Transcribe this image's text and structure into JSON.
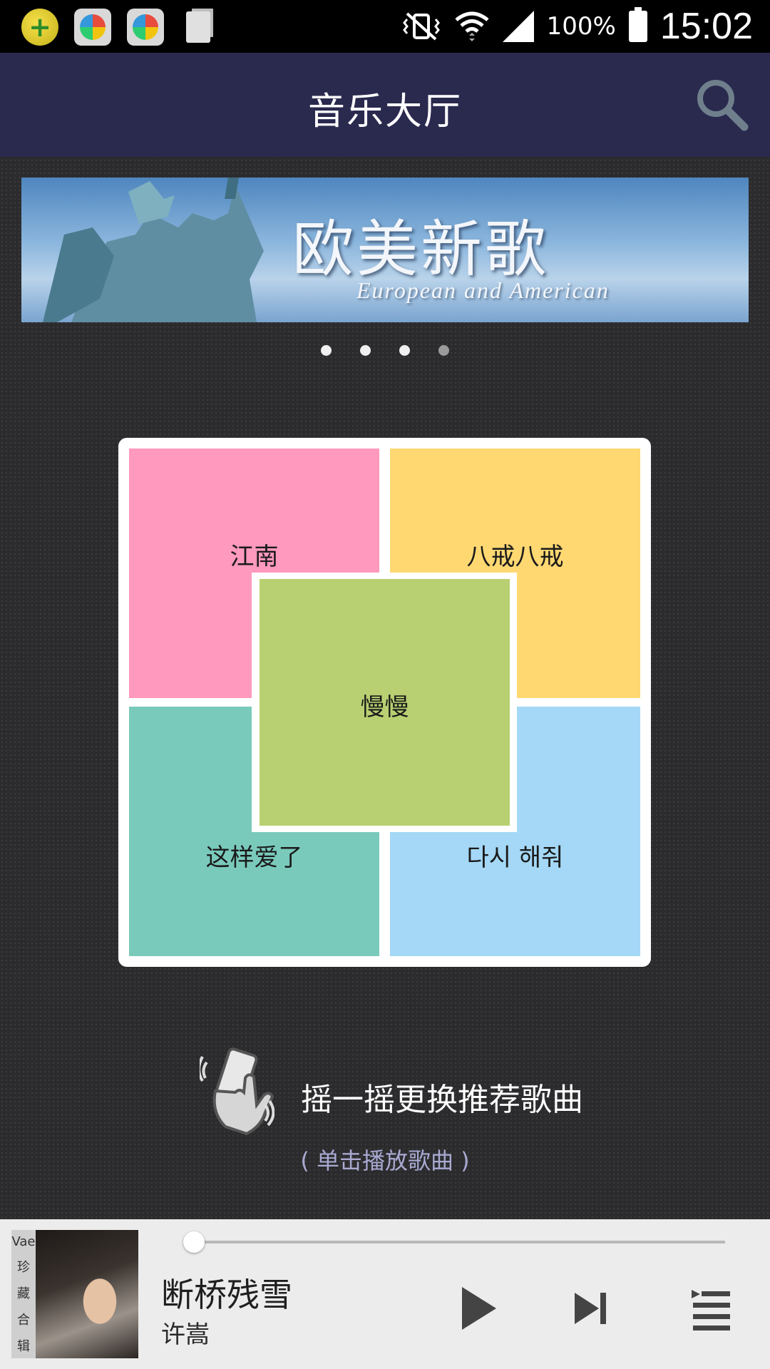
{
  "status_bar": {
    "battery_percent": "100%",
    "time": "15:02",
    "icons": [
      "360-plus-icon",
      "app-ball-icon",
      "app-ball-icon",
      "document-icon",
      "vibrate-mute-icon",
      "wifi-icon",
      "signal-icon",
      "battery-icon"
    ]
  },
  "header": {
    "title": "音乐大厅",
    "search_icon": "search-icon"
  },
  "banner": {
    "title": "欧美新歌",
    "subtitle": "European and American",
    "page_count": 4,
    "active_page": 4
  },
  "recommend": {
    "tiles": [
      {
        "label": "江南",
        "color": "#ff99be"
      },
      {
        "label": "八戒八戒",
        "color": "#ffd872"
      },
      {
        "label": "这样爱了",
        "color": "#7acabc"
      },
      {
        "label": "다시 해줘",
        "color": "#a4d8f6"
      }
    ],
    "center": {
      "label": "慢慢",
      "color": "#b8d072"
    }
  },
  "shake": {
    "label": "摇一摇更换推荐歌曲",
    "hint": "( 单击播放歌曲 )"
  },
  "player": {
    "album_strip": [
      "Vae",
      "珍",
      "藏",
      "合",
      "辑"
    ],
    "title": "断桥残雪",
    "artist": "许嵩",
    "progress": 0.0,
    "controls": [
      "play-icon",
      "next-icon",
      "playlist-icon"
    ]
  },
  "colors": {
    "header_bg": "#2a2a4f",
    "body_bg": "#2b2b2d",
    "player_bg": "#ececec",
    "hint_text": "#a9a9d2"
  }
}
